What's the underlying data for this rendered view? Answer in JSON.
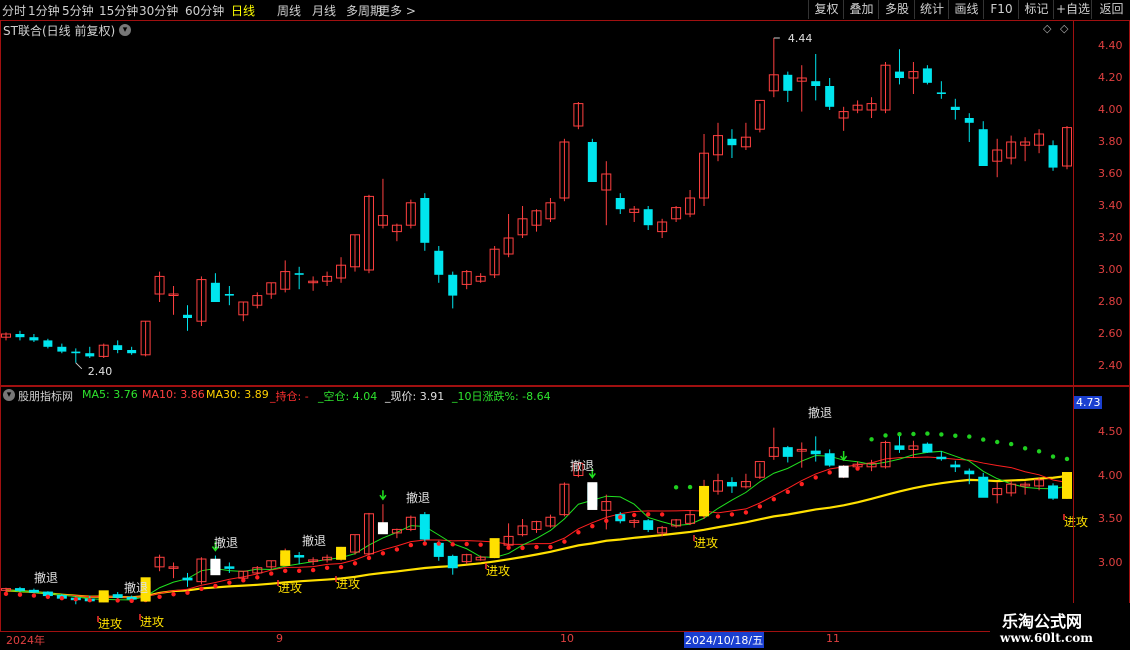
{
  "toolbar": {
    "periods": [
      "分时",
      "1分钟",
      "5分钟",
      "15分钟",
      "30分钟",
      "60分钟",
      "日线",
      "周线",
      "月线",
      "多周期",
      "更多 >"
    ],
    "active_period": "日线",
    "tools": [
      "复权",
      "叠加",
      "多股",
      "统计",
      "画线",
      "F10",
      "标记",
      "+自选",
      "返回"
    ]
  },
  "main_chart": {
    "title": "ST联合(日线 前复权)",
    "y_ticks": [
      "4.40",
      "4.20",
      "4.00",
      "3.80",
      "3.60",
      "3.40",
      "3.20",
      "3.00",
      "2.80",
      "2.60",
      "2.40"
    ],
    "high_label": "4.44",
    "low_label": "2.40"
  },
  "indicator": {
    "name": "股朋指标网",
    "values": [
      {
        "text": "MA5: 3.76",
        "color": "#2ee42e"
      },
      {
        "text": "MA10: 3.86",
        "color": "#ff4040"
      },
      {
        "text": "MA30: 3.89",
        "color": "#ffd000"
      },
      {
        "text": "_持仓: -",
        "color": "#ff3030"
      },
      {
        "text": "_空仓: 4.04",
        "color": "#2ee42e"
      },
      {
        "text": "_现价: 3.91",
        "color": "#e0e0e0"
      },
      {
        "text": "_10日涨跌%: -8.64",
        "color": "#2ee42e"
      }
    ],
    "y_ticks": [
      "4.50",
      "4.00",
      "3.50",
      "3.00"
    ],
    "current_value": "4.73",
    "retreat_label": "撤退",
    "attack_label": "进攻"
  },
  "x_axis": {
    "labels": [
      "2024年",
      "9",
      "10",
      "2024/10/18/五",
      "11"
    ]
  },
  "watermark": {
    "line1": "乐淘公式网",
    "line2": "www.60lt.com"
  },
  "colors": {
    "up": "#ff4040",
    "down": "#00e5ee",
    "grid": "#a01010"
  },
  "chart_data": {
    "type": "candlestick",
    "candles": [
      [
        2.58,
        2.61,
        2.56,
        2.6
      ],
      [
        2.6,
        2.62,
        2.56,
        2.58
      ],
      [
        2.58,
        2.6,
        2.55,
        2.56
      ],
      [
        2.56,
        2.57,
        2.51,
        2.52
      ],
      [
        2.52,
        2.54,
        2.48,
        2.49
      ],
      [
        2.49,
        2.51,
        2.42,
        2.48
      ],
      [
        2.48,
        2.52,
        2.45,
        2.46
      ],
      [
        2.46,
        2.54,
        2.45,
        2.53
      ],
      [
        2.53,
        2.56,
        2.48,
        2.5
      ],
      [
        2.5,
        2.52,
        2.47,
        2.48
      ],
      [
        2.47,
        2.68,
        2.46,
        2.68
      ],
      [
        2.85,
        2.99,
        2.8,
        2.96
      ],
      [
        2.85,
        2.9,
        2.72,
        2.85
      ],
      [
        2.72,
        2.78,
        2.62,
        2.7
      ],
      [
        2.68,
        2.96,
        2.65,
        2.94
      ],
      [
        2.92,
        2.98,
        2.8,
        2.8
      ],
      [
        2.85,
        2.9,
        2.78,
        2.84
      ],
      [
        2.72,
        2.8,
        2.68,
        2.8
      ],
      [
        2.78,
        2.86,
        2.76,
        2.84
      ],
      [
        2.85,
        2.92,
        2.82,
        2.92
      ],
      [
        2.88,
        3.06,
        2.86,
        2.99
      ],
      [
        2.98,
        3.02,
        2.88,
        2.97
      ],
      [
        2.93,
        2.96,
        2.87,
        2.93
      ],
      [
        2.93,
        2.99,
        2.9,
        2.96
      ],
      [
        2.95,
        3.08,
        2.92,
        3.03
      ],
      [
        3.02,
        3.22,
        2.99,
        3.22
      ],
      [
        3.0,
        3.47,
        2.98,
        3.46
      ],
      [
        3.28,
        3.57,
        3.26,
        3.34
      ],
      [
        3.24,
        3.29,
        3.18,
        3.28
      ],
      [
        3.28,
        3.44,
        3.26,
        3.42
      ],
      [
        3.45,
        3.48,
        3.12,
        3.17
      ],
      [
        3.12,
        3.15,
        2.92,
        2.97
      ],
      [
        2.97,
        2.99,
        2.76,
        2.84
      ],
      [
        2.91,
        3.0,
        2.88,
        2.99
      ],
      [
        2.93,
        2.98,
        2.92,
        2.96
      ],
      [
        2.97,
        3.15,
        2.95,
        3.13
      ],
      [
        3.1,
        3.35,
        3.08,
        3.2
      ],
      [
        3.22,
        3.4,
        3.2,
        3.32
      ],
      [
        3.28,
        3.38,
        3.24,
        3.37
      ],
      [
        3.32,
        3.45,
        3.3,
        3.42
      ],
      [
        3.45,
        3.82,
        3.43,
        3.8
      ],
      [
        3.9,
        4.05,
        3.88,
        4.04
      ],
      [
        3.8,
        3.82,
        3.6,
        3.55
      ],
      [
        3.5,
        3.68,
        3.28,
        3.6
      ],
      [
        3.45,
        3.48,
        3.35,
        3.38
      ],
      [
        3.36,
        3.4,
        3.3,
        3.38
      ],
      [
        3.38,
        3.4,
        3.25,
        3.28
      ],
      [
        3.24,
        3.32,
        3.2,
        3.3
      ],
      [
        3.32,
        3.4,
        3.3,
        3.39
      ],
      [
        3.35,
        3.5,
        3.33,
        3.45
      ],
      [
        3.45,
        3.85,
        3.4,
        3.73
      ],
      [
        3.72,
        3.92,
        3.68,
        3.84
      ],
      [
        3.82,
        3.88,
        3.7,
        3.78
      ],
      [
        3.77,
        3.92,
        3.75,
        3.83
      ],
      [
        3.88,
        4.04,
        3.86,
        4.06
      ],
      [
        4.12,
        4.45,
        4.08,
        4.22
      ],
      [
        4.22,
        4.24,
        4.05,
        4.12
      ],
      [
        4.18,
        4.28,
        3.99,
        4.2
      ],
      [
        4.18,
        4.35,
        4.06,
        4.15
      ],
      [
        4.15,
        4.2,
        4.0,
        4.02
      ],
      [
        3.95,
        4.02,
        3.87,
        3.99
      ],
      [
        4.0,
        4.06,
        3.98,
        4.03
      ],
      [
        4.0,
        4.08,
        3.95,
        4.04
      ],
      [
        4.0,
        4.3,
        3.98,
        4.28
      ],
      [
        4.24,
        4.38,
        4.16,
        4.2
      ],
      [
        4.2,
        4.3,
        4.1,
        4.24
      ],
      [
        4.26,
        4.28,
        4.16,
        4.17
      ],
      [
        4.11,
        4.18,
        4.07,
        4.1
      ],
      [
        4.02,
        4.07,
        3.94,
        4.0
      ],
      [
        3.95,
        3.98,
        3.8,
        3.92
      ],
      [
        3.88,
        3.93,
        3.72,
        3.65
      ],
      [
        3.68,
        3.82,
        3.58,
        3.75
      ],
      [
        3.7,
        3.84,
        3.66,
        3.8
      ],
      [
        3.78,
        3.83,
        3.68,
        3.8
      ],
      [
        3.78,
        3.88,
        3.73,
        3.85
      ],
      [
        3.78,
        3.81,
        3.62,
        3.64
      ],
      [
        3.65,
        3.9,
        3.63,
        3.89
      ]
    ]
  }
}
